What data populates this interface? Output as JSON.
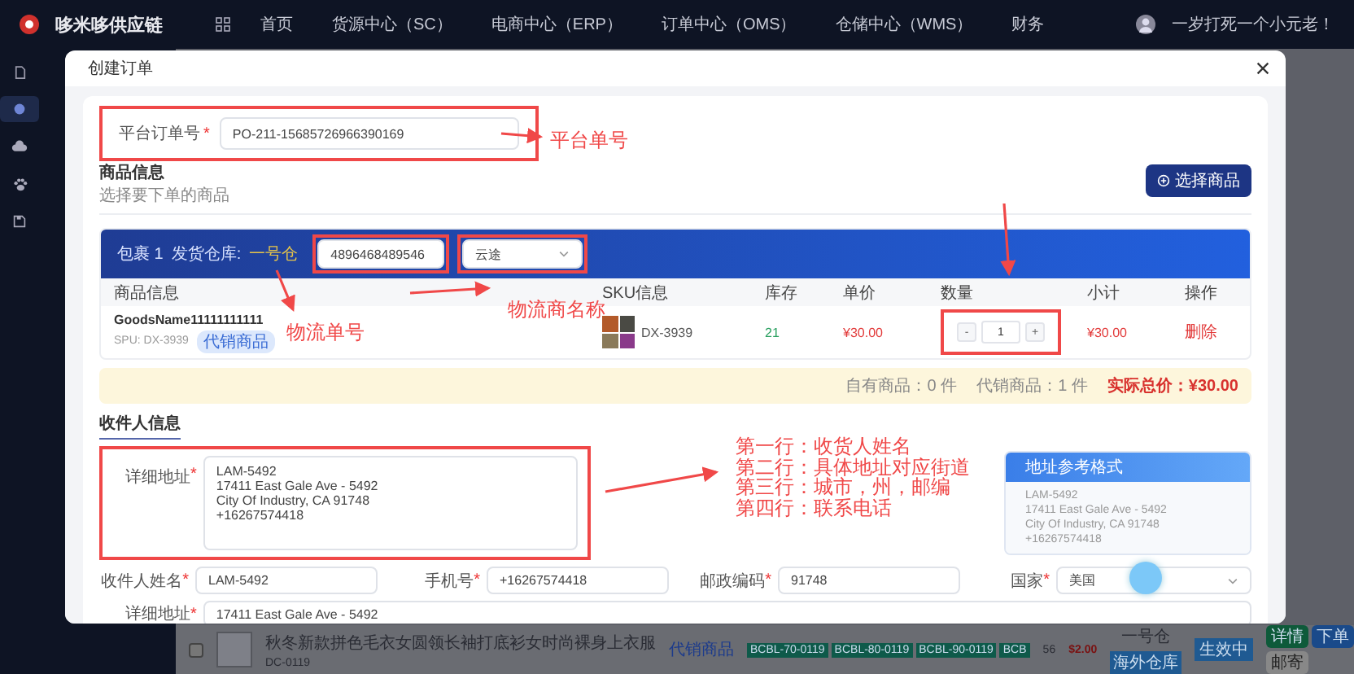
{
  "topbar": {
    "brand": "哆米哆供应链",
    "nav": [
      {
        "label": "首页",
        "selected": false
      },
      {
        "label": "货源中心（SC）",
        "selected": false
      },
      {
        "label": "电商中心（ERP）",
        "selected": false
      },
      {
        "label": "订单中心（OMS）",
        "selected": false
      },
      {
        "label": "仓储中心（WMS）",
        "selected": false
      },
      {
        "label": "财务",
        "selected": false
      }
    ],
    "user": "一岁打死一个小元老！"
  },
  "sidebar": {
    "items": [
      {
        "kind": "doc",
        "selected": false
      },
      {
        "kind": "circle",
        "selected": true
      },
      {
        "kind": "cloud",
        "selected": false
      },
      {
        "kind": "paw",
        "selected": false
      },
      {
        "kind": "disk",
        "selected": false
      }
    ]
  },
  "modal": {
    "title": "创建订单",
    "platform_order": {
      "label": "平台订单号",
      "mark": "*",
      "value": "PO-211-15685726966390169",
      "highlighted": true
    },
    "goods": {
      "title": "商品信息",
      "subtitle": "选择要下单的商品",
      "select_button": "选择商品",
      "package": {
        "label": "包裹 1",
        "warehouse_label": "发货仓库:",
        "warehouse": "一号仓",
        "tracking_number": "4896468489546",
        "tracking_highlighted": true,
        "carrier": "云途",
        "carrier_highlighted": true
      },
      "columns": [
        "商品信息",
        "SKU信息",
        "库存",
        "单价",
        "数量",
        "小计",
        "操作"
      ],
      "rows": [
        {
          "name": "GoodsName11111111111",
          "spu": "SPU: DX-3939",
          "badge": "代销商品",
          "sku": "DX-3939",
          "stock": "21",
          "price": "¥30.00",
          "decrement": "-",
          "quantity": "1",
          "increment": "+",
          "quantity_highlighted": true,
          "subtotal": "¥30.00",
          "action": "删除"
        }
      ]
    },
    "summary": {
      "own": "自有商品：0 件",
      "consign": "代销商品：1 件",
      "total_label": "实际总价：",
      "total": "¥30.00"
    },
    "recipient": {
      "tab": "收件人信息",
      "address": {
        "label": "详细地址",
        "mark": "*",
        "lines": [
          "LAM-5492",
          "17411 East Gale Ave - 5492",
          "City Of Industry, CA 91748",
          "+16267574418"
        ],
        "highlighted": true
      },
      "format_card": {
        "title": "地址参考格式",
        "lines": [
          "LAM-5492",
          "17411 East Gale Ave - 5492",
          "City Of Industry, CA 91748",
          "+16267574418"
        ]
      },
      "fields": [
        {
          "kind": "input",
          "label": "收件人姓名",
          "mark": "*",
          "value": "LAM-5492"
        },
        {
          "kind": "input",
          "label": "手机号",
          "mark": "*",
          "value": "+16267574418"
        },
        {
          "kind": "input",
          "label": "邮政编码",
          "mark": "*",
          "value": "91748"
        },
        {
          "kind": "select",
          "label": "国家",
          "mark": "*",
          "value": "美国"
        }
      ],
      "street": {
        "label": "详细地址",
        "mark": "*",
        "value": "17411 East Gale Ave - 5492"
      }
    }
  },
  "annotations": {
    "platform": "平台单号",
    "tracking": "物流单号",
    "carrier": "物流商名称",
    "notes": [
      "第一行：收货人姓名",
      "第二行：具体地址对应街道",
      "第三行：城市，州，邮编",
      "第四行：联系电话"
    ]
  },
  "background_row": {
    "checked": false,
    "title": "秋冬新款拼色毛衣女圆领长袖打底衫女时尚裸身上衣服",
    "sku": "DC-0119",
    "type": "代销商品",
    "tags": [
      "BCBL-70-0119",
      "BCBL-80-0119",
      "BCBL-90-0119",
      "BCB"
    ],
    "stock": "56",
    "price": "$2.00",
    "warehouse": "一号仓",
    "warehouse_tag": "海外仓库",
    "status": "生效中",
    "buttons": [
      "详情",
      "下单",
      "邮寄"
    ]
  }
}
